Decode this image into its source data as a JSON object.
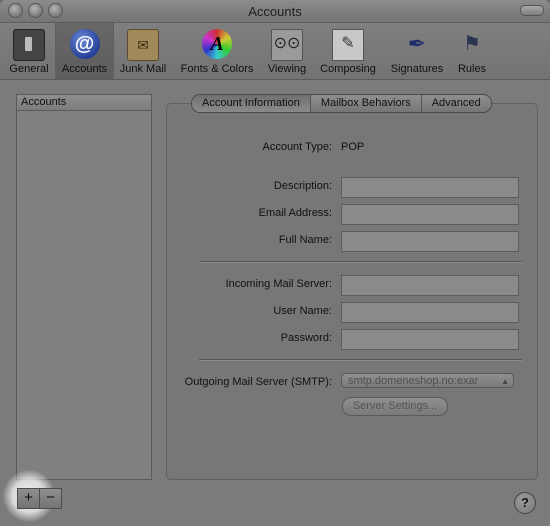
{
  "window": {
    "title": "Accounts"
  },
  "toolbar": {
    "items": [
      {
        "label": "General",
        "icon": "general-switch-icon"
      },
      {
        "label": "Accounts",
        "icon": "at-sign-icon",
        "selected": true
      },
      {
        "label": "Junk Mail",
        "icon": "junk-mail-icon"
      },
      {
        "label": "Fonts & Colors",
        "icon": "fonts-colors-icon"
      },
      {
        "label": "Viewing",
        "icon": "viewing-glasses-icon"
      },
      {
        "label": "Composing",
        "icon": "composing-pen-icon"
      },
      {
        "label": "Signatures",
        "icon": "signature-pen-icon"
      },
      {
        "label": "Rules",
        "icon": "rules-icon"
      }
    ]
  },
  "sidebar": {
    "header": "Accounts"
  },
  "tabs": [
    "Account Information",
    "Mailbox Behaviors",
    "Advanced"
  ],
  "form": {
    "account_type_label": "Account Type:",
    "account_type_value": "POP",
    "description_label": "Description:",
    "description_value": "",
    "email_label": "Email Address:",
    "email_value": "",
    "fullname_label": "Full Name:",
    "fullname_value": "",
    "incoming_label": "Incoming Mail Server:",
    "incoming_value": "",
    "username_label": "User Name:",
    "username_value": "",
    "password_label": "Password:",
    "password_value": "",
    "smtp_label": "Outgoing Mail Server (SMTP):",
    "smtp_value": "smtp.domeneshop.no:exar",
    "server_settings_label": "Server Settings..."
  },
  "buttons": {
    "add": "+",
    "remove": "−",
    "help": "?"
  }
}
